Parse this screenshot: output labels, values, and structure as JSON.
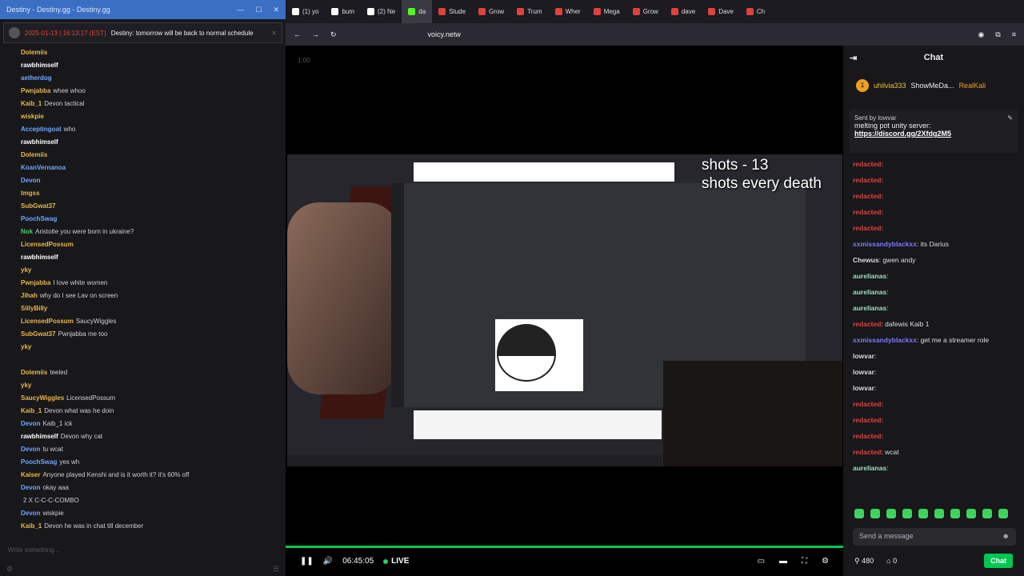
{
  "left": {
    "title": "Destiny - Destiny.gg - Destiny.gg",
    "pinned": {
      "user": "Destiny",
      "prefix": "2025-01-13 | 16:13:17 (EST)",
      "text": "Destiny: tomorrow will be back to normal schedule"
    },
    "messages": [
      {
        "u": "Dolemiis",
        "t": "",
        "c": "#e9b64a"
      },
      {
        "u": "rawbhimself",
        "t": "",
        "c": "#ffffff"
      },
      {
        "u": "aetherdog",
        "t": "",
        "c": "#6da7ff"
      },
      {
        "u": "Pwnjabba",
        "t": "whee whoo",
        "c": "#e9b64a"
      },
      {
        "u": "Kaib_1",
        "t": "Devon tactical",
        "c": "#e9b64a"
      },
      {
        "u": "wiskpie",
        "t": "",
        "c": "#e9b64a"
      },
      {
        "u": "Acceptingoat",
        "t": "who",
        "c": "#6da7ff"
      },
      {
        "u": "rawbhimself",
        "t": "",
        "c": "#ffffff"
      },
      {
        "u": "Dolemiis",
        "t": "",
        "c": "#e9b64a"
      },
      {
        "u": "KoanVernanoa",
        "t": "",
        "c": "#6da7ff"
      },
      {
        "u": "Devon",
        "t": "",
        "c": "#6da7ff"
      },
      {
        "u": "tmgss",
        "t": "",
        "c": "#e9b64a"
      },
      {
        "u": "SubGwat37",
        "t": "",
        "c": "#e9b64a"
      },
      {
        "u": "PoochSwag",
        "t": "",
        "c": "#6da7ff"
      },
      {
        "u": "Nok",
        "t": "Aristotle you were born in ukraine?",
        "c": "#3ed35e"
      },
      {
        "u": "LicensedPossum",
        "t": "",
        "c": "#e9b64a"
      },
      {
        "u": "rawbhimself",
        "t": "",
        "c": "#ffffff"
      },
      {
        "u": "yky",
        "t": "",
        "c": "#e9b64a"
      },
      {
        "u": "Pwnjabba",
        "t": "I love white women",
        "c": "#e9b64a"
      },
      {
        "u": "Jihah",
        "t": "why do I see Lav on screen",
        "c": "#e9b64a"
      },
      {
        "u": "SillyBilly",
        "t": "",
        "c": "#e9b64a"
      },
      {
        "u": "LicensedPossum",
        "t": "SaucyWiggles",
        "c": "#e9b64a"
      },
      {
        "u": "SubGwat37",
        "t": "Pwnjabba me too",
        "c": "#e9b64a"
      },
      {
        "u": "yky",
        "t": "",
        "c": "#e9b64a"
      },
      {
        "u": "",
        "t": "",
        "c": "#e9b64a"
      },
      {
        "u": "Dolemiis",
        "t": "teeled",
        "c": "#e9b64a"
      },
      {
        "u": "yky",
        "t": "",
        "c": "#e9b64a"
      },
      {
        "u": "SaucyWiggles",
        "t": "LicensedPossum",
        "c": "#e9b64a"
      },
      {
        "u": "Kaib_1",
        "t": "Devon what was he doin",
        "c": "#e9b64a"
      },
      {
        "u": "Devon",
        "t": "Kaib_1 ick",
        "c": "#6da7ff"
      },
      {
        "u": "rawbhimself",
        "t": "Devon why cat",
        "c": "#ffffff"
      },
      {
        "u": "Devon",
        "t": "tu wcat",
        "c": "#6da7ff"
      },
      {
        "u": "PoochSwag",
        "t": "yes wh",
        "c": "#6da7ff"
      },
      {
        "u": "Kaiser",
        "t": "Anyone played Kenshi and is it worth it? it's 60% off",
        "c": "#e9b64a"
      },
      {
        "u": "Devon",
        "t": "okay aaa",
        "c": "#6da7ff"
      },
      {
        "u": "",
        "t": "2 X C-C-C-COMBO",
        "c": "#ffffff"
      },
      {
        "u": "Devon",
        "t": "wiskpie",
        "c": "#6da7ff"
      },
      {
        "u": "Kaib_1",
        "t": "Devon he was in chat till december",
        "c": "#e9b64a"
      }
    ],
    "input_placeholder": "Write something..."
  },
  "browser": {
    "tabs": [
      {
        "label": "(1) yo",
        "fav": "#ffffff"
      },
      {
        "label": "bum",
        "fav": "#ffffff"
      },
      {
        "label": "(2) Ne",
        "fav": "#ffffff"
      },
      {
        "label": "da",
        "fav": "#53fc18",
        "active": true
      },
      {
        "label": "Stude",
        "fav": "#e0423a"
      },
      {
        "label": "Grow",
        "fav": "#e0423a"
      },
      {
        "label": "Trum",
        "fav": "#e0423a"
      },
      {
        "label": "Wher",
        "fav": "#e0423a"
      },
      {
        "label": "Mega",
        "fav": "#e0423a"
      },
      {
        "label": "Grow",
        "fav": "#e0423a"
      },
      {
        "label": "dave",
        "fav": "#e0423a"
      },
      {
        "label": "Dave",
        "fav": "#e0423a"
      },
      {
        "label": "Ch",
        "fav": "#e0423a"
      }
    ],
    "url": "voicy.netw"
  },
  "player": {
    "overlay_line1": "shots - 13",
    "overlay_line2": "shots every death",
    "time": "06:45:05",
    "live": "LIVE",
    "timer": "1:00",
    "face_left": "",
    "progress": 1.0
  },
  "chat": {
    "title": "Chat",
    "gift_user": "uhilvia333",
    "gift_count": "1",
    "gift_users": [
      "ShowMeDa...",
      "RealKali"
    ],
    "ann_sender": "Sent by",
    "ann_user": "lowvar",
    "ann_text": "melting pot unity server:",
    "ann_link": "https://discord.gg/2Xfdg2M5",
    "messages": [
      {
        "u": "redacted",
        "t": ""
      },
      {
        "u": "redacted",
        "t": ""
      },
      {
        "u": "redacted",
        "t": ""
      },
      {
        "u": "redacted",
        "t": ""
      },
      {
        "u": "redacted",
        "t": ""
      },
      {
        "u": "xxmissandyblackxx",
        "t": "its Darius",
        "cls": "b"
      },
      {
        "u": "Chewus",
        "t": "gwen andy",
        "cls": "w"
      },
      {
        "u": "aurelianas",
        "t": "",
        "cls": "g"
      },
      {
        "u": "aurelianas",
        "t": "",
        "cls": "g"
      },
      {
        "u": "aurelianas",
        "t": "",
        "cls": "g"
      },
      {
        "u": "redacted",
        "t": "dafewis Kaib 1"
      },
      {
        "u": "xxmissandyblackxx",
        "t": "get me a streamer role",
        "cls": "b"
      },
      {
        "u": "lowvar",
        "t": "",
        "cls": "w"
      },
      {
        "u": "lowvar",
        "t": "",
        "cls": "w"
      },
      {
        "u": "lowvar",
        "t": "",
        "cls": "w"
      },
      {
        "u": "redacted",
        "t": ""
      },
      {
        "u": "redacted",
        "t": ""
      },
      {
        "u": "redacted",
        "t": ""
      },
      {
        "u": "redacted",
        "t": "wcat"
      },
      {
        "u": "aurelianas",
        "t": "",
        "cls": "g"
      }
    ],
    "placeholder": "Send a message",
    "viewers": "480",
    "count2": "0",
    "chat_btn": "Chat"
  }
}
